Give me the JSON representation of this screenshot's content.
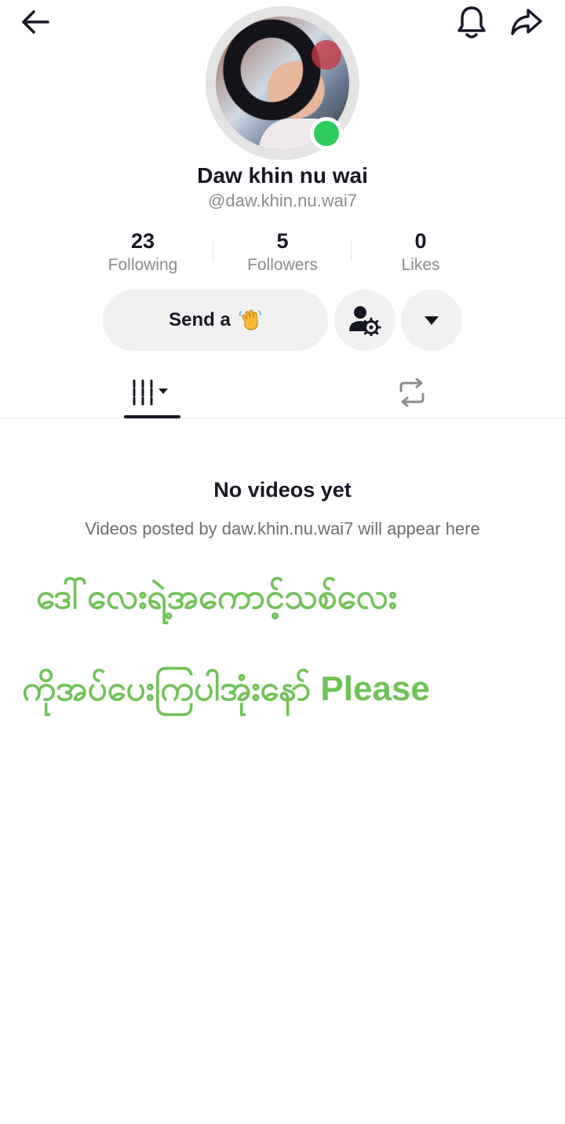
{
  "profile": {
    "display_name": "Daw khin nu wai",
    "handle": "@daw.khin.nu.wai7",
    "online": true
  },
  "stats": [
    {
      "value": "23",
      "label": "Following"
    },
    {
      "value": "5",
      "label": "Followers"
    },
    {
      "value": "0",
      "label": "Likes"
    }
  ],
  "actions": {
    "send_label": "Send a",
    "send_emoji": "waving-hand-icon"
  },
  "icons": {
    "back": "arrow-left-icon",
    "notifications": "bell-icon",
    "share": "share-arrow-icon",
    "profile_settings": "user-gear-icon",
    "more": "caret-down-icon",
    "videos_tab": "grid-sort-icon",
    "reposts_tab": "repost-icon"
  },
  "empty_state": {
    "title": "No videos yet",
    "description": "Videos posted by daw.khin.nu.wai7 will appear here"
  },
  "overlay": {
    "line1": "ဒေါ်လေးရဲ့အကောင့်သစ်လေး",
    "line2": "ကိုအပ်ပေးကြပါအုံးနော် Please",
    "color": "#6fc257"
  },
  "colors": {
    "online": "#2ecc5f",
    "button_bg": "#f1f1f2",
    "text_primary": "#161823",
    "text_secondary": "#8a8b91"
  }
}
